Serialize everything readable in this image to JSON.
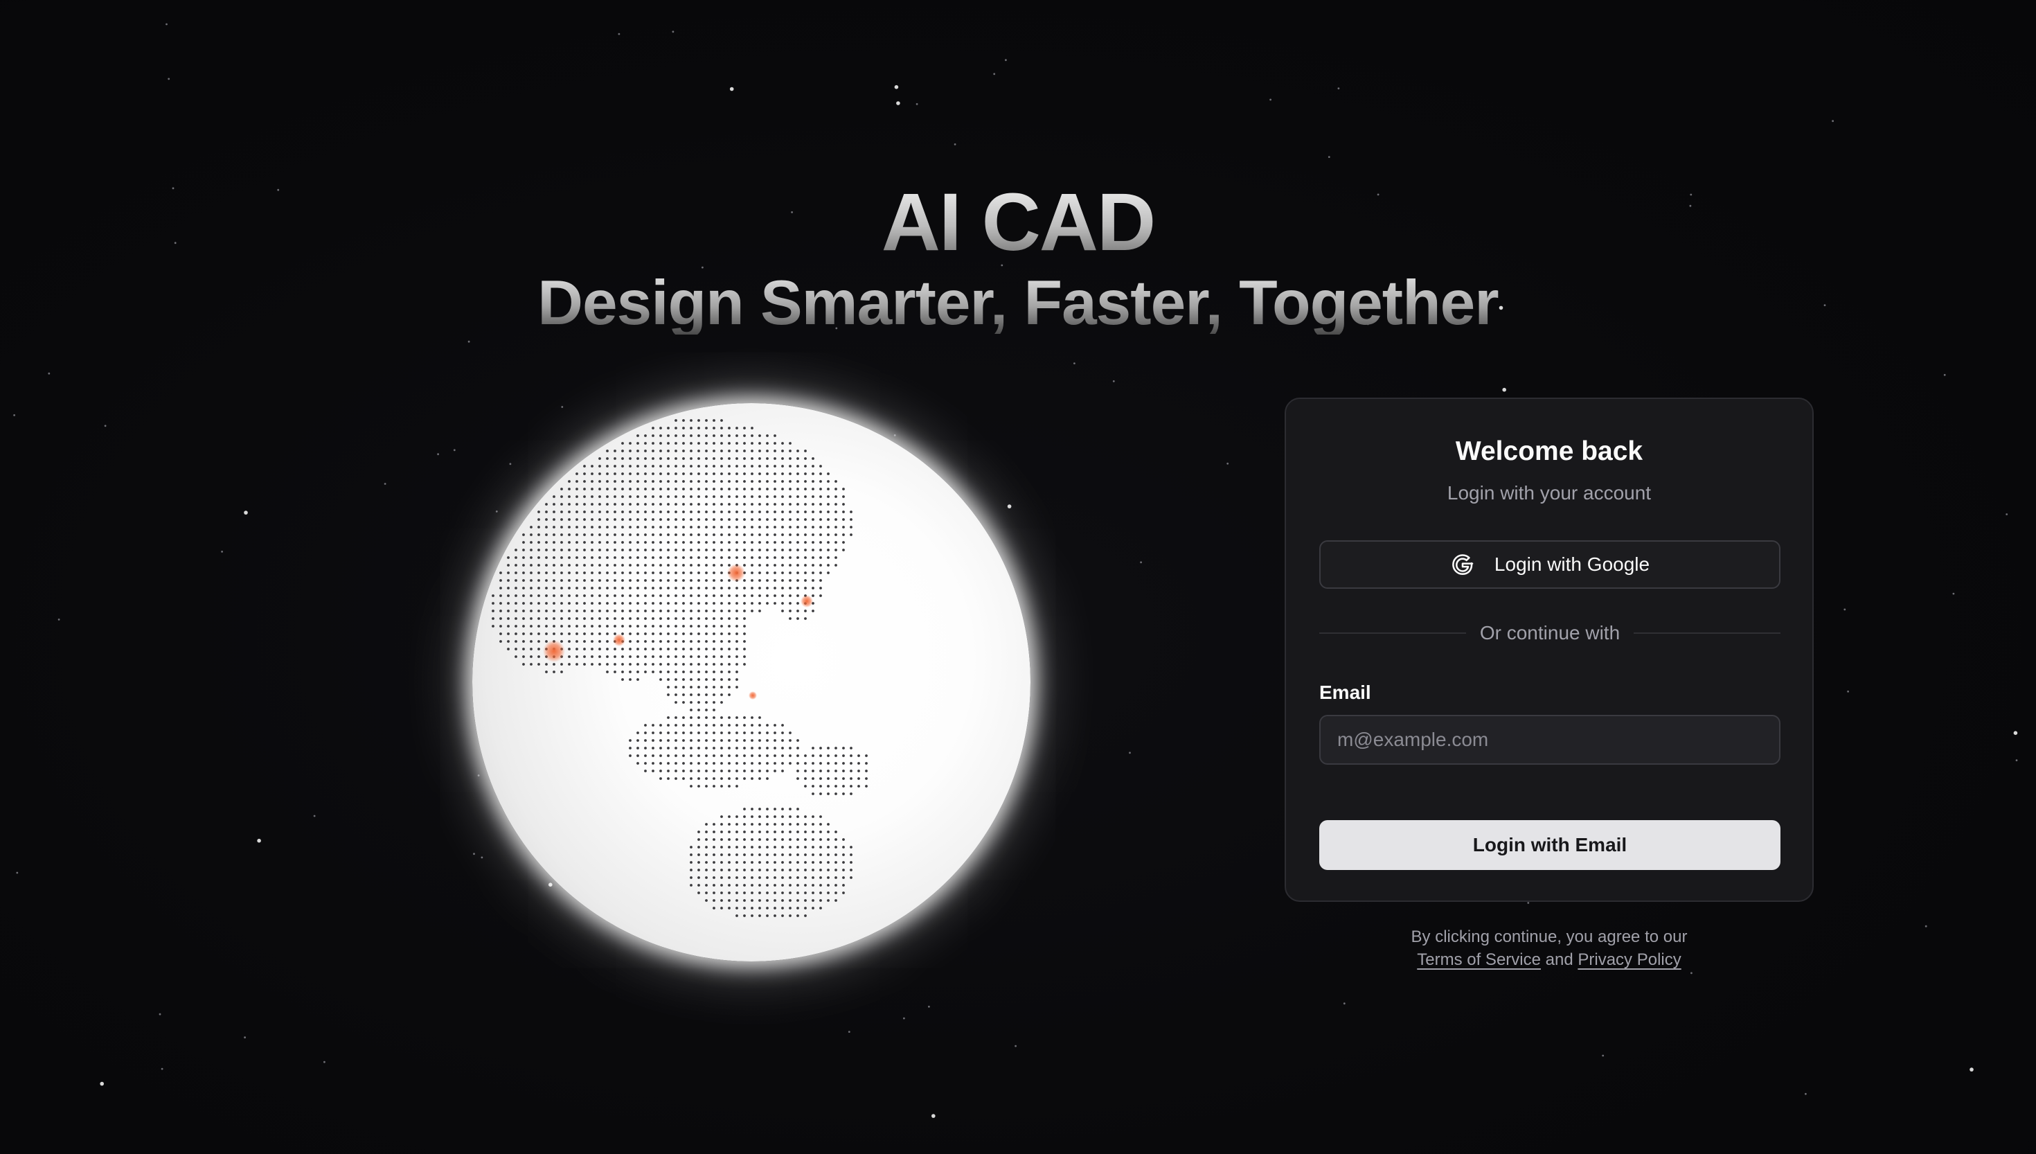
{
  "hero": {
    "title": "AI CAD",
    "subtitle": "Design Smarter, Faster, Together"
  },
  "login": {
    "title": "Welcome back",
    "subtitle": "Login with your account",
    "google_button_label": "Login with Google",
    "google_icon": "google-icon",
    "divider_text": "Or continue with",
    "email_label": "Email",
    "email_placeholder": "m@example.com",
    "email_value": "",
    "email_button_label": "Login with Email"
  },
  "legal": {
    "prefix": "By clicking continue, you agree to our",
    "terms_link": "Terms of Service",
    "conjunction": "and",
    "privacy_link": "Privacy Policy"
  },
  "colors": {
    "background": "#0a0a0c",
    "card": "#18181b",
    "accent_marker": "#f26b3a",
    "primary_button": "#e4e4e7"
  }
}
